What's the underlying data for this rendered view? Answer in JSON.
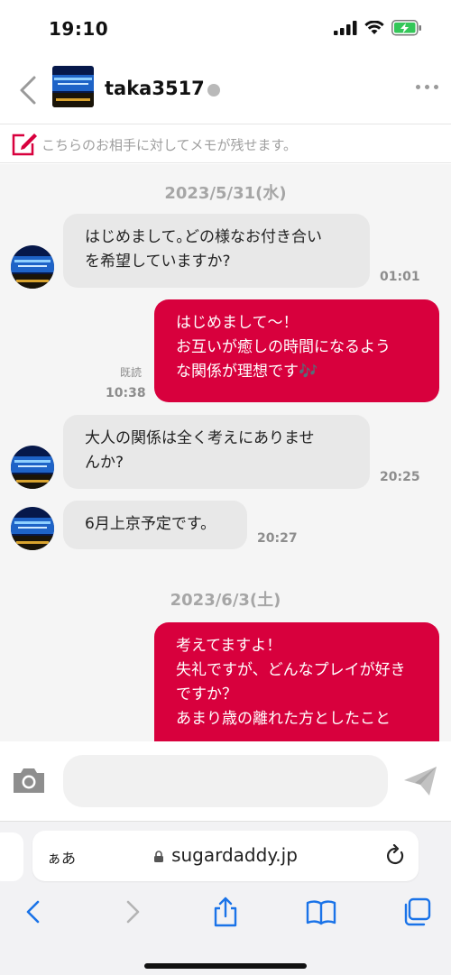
{
  "status": {
    "time": "19:10"
  },
  "header": {
    "partner_name": "taka3517",
    "status": "offline"
  },
  "memo": {
    "placeholder": "こちらのお相手に対してメモが残せます。"
  },
  "messages": {
    "date1": "2023/5/31(水)",
    "date2": "2023/6/3(土)",
    "m1": {
      "line1": "はじめまして｡どの様なお付き合い",
      "line2": "を希望していますか?",
      "time": "01:01"
    },
    "m2": {
      "line1": "はじめまして〜！",
      "line2": "お互いが癒しの時間になるよう",
      "line3": "な関係が理想です🎶",
      "read": "既読",
      "time": "10:38"
    },
    "m3": {
      "line1": "大人の関係は全く考えにありませ",
      "line2": "んか?",
      "time": "20:25"
    },
    "m4": {
      "line1": "6月上京予定です。",
      "time": "20:27"
    },
    "m5": {
      "line1": "考えてますよ！",
      "line2": "失礼ですが、どんなプレイが好き",
      "line3": "ですか？",
      "line4": "あまり歳の離れた方としたこと"
    }
  },
  "safari": {
    "aa": "ぁあ",
    "url": "sugardaddy.jp"
  },
  "colors": {
    "accent": "#d8003d",
    "incoming": "#e8e8e8",
    "ios_blue": "#1a73e8"
  }
}
